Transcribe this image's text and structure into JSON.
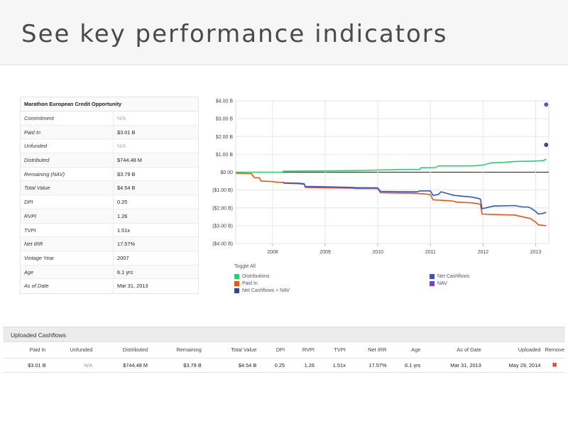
{
  "banner": {
    "title": "See key performance indicators"
  },
  "fund": {
    "name": "Marathon European Credit Opportunity",
    "rows": [
      {
        "label": "Commitment",
        "value": "N/A"
      },
      {
        "label": "Paid In",
        "value": "$3.01 B"
      },
      {
        "label": "Unfunded",
        "value": "N/A"
      },
      {
        "label": "Distributed",
        "value": "$744.48 M"
      },
      {
        "label": "Remaining (NAV)",
        "value": "$3.79 B"
      },
      {
        "label": "Total Value",
        "value": "$4.54 B"
      },
      {
        "label": "DPI",
        "value": "0.25"
      },
      {
        "label": "RVPI",
        "value": "1.26"
      },
      {
        "label": "TVPI",
        "value": "1.51x"
      },
      {
        "label": "Net IRR",
        "value": "17.57%"
      },
      {
        "label": "Vintage Year",
        "value": "2007"
      },
      {
        "label": "Age",
        "value": "6.1 yrs"
      },
      {
        "label": "As of Date",
        "value": "Mar 31, 2013"
      }
    ]
  },
  "chart_data": {
    "type": "line",
    "title": "",
    "xlabel": "",
    "ylabel": "",
    "ylim": [
      -4,
      4
    ],
    "xlim": [
      2007.3,
      2013.25
    ],
    "yticks": [
      4,
      3,
      2,
      1,
      0,
      -1,
      -2,
      -3,
      -4
    ],
    "ytick_labels": [
      "$4.00 B",
      "$3.00 B",
      "$2.00 B",
      "$1.00 B",
      "$0.00",
      "($1.00 B)",
      "($2.00 B)",
      "($3.00 B)",
      "($4.00 B)"
    ],
    "xticks": [
      2008,
      2009,
      2010,
      2011,
      2012,
      2013
    ],
    "xtick_labels": [
      "2008",
      "2009",
      "2010",
      "2011",
      "2012",
      "2013"
    ],
    "grid": true,
    "legend_position": "bottom",
    "series": [
      {
        "name": "Distributions",
        "color": "#2ecc71",
        "points": [
          [
            2007.3,
            0.0
          ],
          [
            2008.2,
            0.0
          ],
          [
            2008.2,
            0.06
          ],
          [
            2009.0,
            0.07
          ],
          [
            2009.7,
            0.1
          ],
          [
            2010.5,
            0.15
          ],
          [
            2010.8,
            0.15
          ],
          [
            2010.82,
            0.25
          ],
          [
            2011.1,
            0.26
          ],
          [
            2011.15,
            0.35
          ],
          [
            2011.8,
            0.35
          ],
          [
            2012.0,
            0.4
          ],
          [
            2012.15,
            0.52
          ],
          [
            2012.4,
            0.55
          ],
          [
            2012.6,
            0.6
          ],
          [
            2012.95,
            0.62
          ],
          [
            2013.15,
            0.65
          ],
          [
            2013.2,
            0.75
          ]
        ]
      },
      {
        "name": "Paid In",
        "color": "#e8541a",
        "points": [
          [
            2007.3,
            -0.05
          ],
          [
            2007.6,
            -0.08
          ],
          [
            2007.65,
            -0.3
          ],
          [
            2007.75,
            -0.32
          ],
          [
            2007.78,
            -0.5
          ],
          [
            2008.0,
            -0.52
          ],
          [
            2008.05,
            -0.55
          ],
          [
            2008.2,
            -0.58
          ],
          [
            2008.22,
            -0.62
          ],
          [
            2008.5,
            -0.65
          ],
          [
            2008.6,
            -0.68
          ],
          [
            2008.62,
            -0.85
          ],
          [
            2009.0,
            -0.87
          ],
          [
            2009.5,
            -0.9
          ],
          [
            2009.6,
            -0.92
          ],
          [
            2010.0,
            -0.92
          ],
          [
            2010.05,
            -1.15
          ],
          [
            2010.5,
            -1.17
          ],
          [
            2010.7,
            -1.18
          ],
          [
            2010.8,
            -1.2
          ],
          [
            2011.0,
            -1.25
          ],
          [
            2011.05,
            -1.55
          ],
          [
            2011.35,
            -1.6
          ],
          [
            2011.45,
            -1.63
          ],
          [
            2011.5,
            -1.68
          ],
          [
            2011.8,
            -1.72
          ],
          [
            2011.95,
            -1.8
          ],
          [
            2011.98,
            -2.35
          ],
          [
            2012.3,
            -2.38
          ],
          [
            2012.6,
            -2.4
          ],
          [
            2012.75,
            -2.5
          ],
          [
            2012.9,
            -2.6
          ],
          [
            2013.0,
            -2.8
          ],
          [
            2013.05,
            -2.95
          ],
          [
            2013.2,
            -3.0
          ]
        ]
      },
      {
        "name": "Net Cashflows",
        "color": "#3355cc",
        "points": [
          [
            2008.2,
            -0.55
          ],
          [
            2008.22,
            -0.6
          ],
          [
            2008.5,
            -0.62
          ],
          [
            2008.6,
            -0.65
          ],
          [
            2008.62,
            -0.8
          ],
          [
            2009.0,
            -0.82
          ],
          [
            2009.5,
            -0.85
          ],
          [
            2009.6,
            -0.87
          ],
          [
            2010.0,
            -0.88
          ],
          [
            2010.05,
            -1.08
          ],
          [
            2010.5,
            -1.1
          ],
          [
            2010.75,
            -1.1
          ],
          [
            2010.8,
            -1.05
          ],
          [
            2011.0,
            -1.05
          ],
          [
            2011.05,
            -1.3
          ],
          [
            2011.15,
            -1.25
          ],
          [
            2011.2,
            -1.1
          ],
          [
            2011.45,
            -1.3
          ],
          [
            2011.8,
            -1.4
          ],
          [
            2011.95,
            -1.5
          ],
          [
            2011.98,
            -2.05
          ],
          [
            2012.2,
            -1.9
          ],
          [
            2012.6,
            -1.87
          ],
          [
            2012.75,
            -1.95
          ],
          [
            2012.85,
            -1.95
          ],
          [
            2012.9,
            -2.0
          ],
          [
            2013.0,
            -2.2
          ],
          [
            2013.05,
            -2.35
          ],
          [
            2013.15,
            -2.3
          ],
          [
            2013.2,
            -2.25
          ]
        ]
      },
      {
        "name": "NAV",
        "color": "#7a3fd6",
        "points": [
          [
            2013.2,
            3.79
          ]
        ]
      },
      {
        "name": "Net Cashflows + NAV",
        "color": "#2f4a8a",
        "points": [
          [
            2013.2,
            1.53
          ]
        ]
      }
    ]
  },
  "legend": {
    "toggle_label": "Toggle All",
    "items": [
      {
        "label": "Distributions",
        "color": "#2ecc71"
      },
      {
        "label": "Paid In",
        "color": "#e8541a"
      },
      {
        "label": "Net Cashflows + NAV",
        "color": "#2f4a8a"
      },
      {
        "label": "Net Cashflows",
        "color": "#3355cc"
      },
      {
        "label": "NAV",
        "color": "#7a3fd6"
      }
    ]
  },
  "cashflows": {
    "title": "Uploaded Cashflows",
    "columns": [
      "Paid In",
      "Unfunded",
      "Distributed",
      "Remaining",
      "Total Value",
      "DPI",
      "RVPI",
      "TVPI",
      "Net IRR",
      "Age",
      "As of Date",
      "Uploaded",
      "Remove"
    ],
    "row": {
      "paid_in": "$3.01 B",
      "unfunded": "N/A",
      "distributed": "$744.48 M",
      "remaining": "$3.79 B",
      "total_value": "$4.54 B",
      "dpi": "0.25",
      "rvpi": "1.26",
      "tvpi": "1.51x",
      "net_irr": "17.57%",
      "age": "6.1 yrs",
      "as_of_date": "Mar 31, 2013",
      "uploaded": "May 29, 2014",
      "remove": "✖"
    }
  }
}
